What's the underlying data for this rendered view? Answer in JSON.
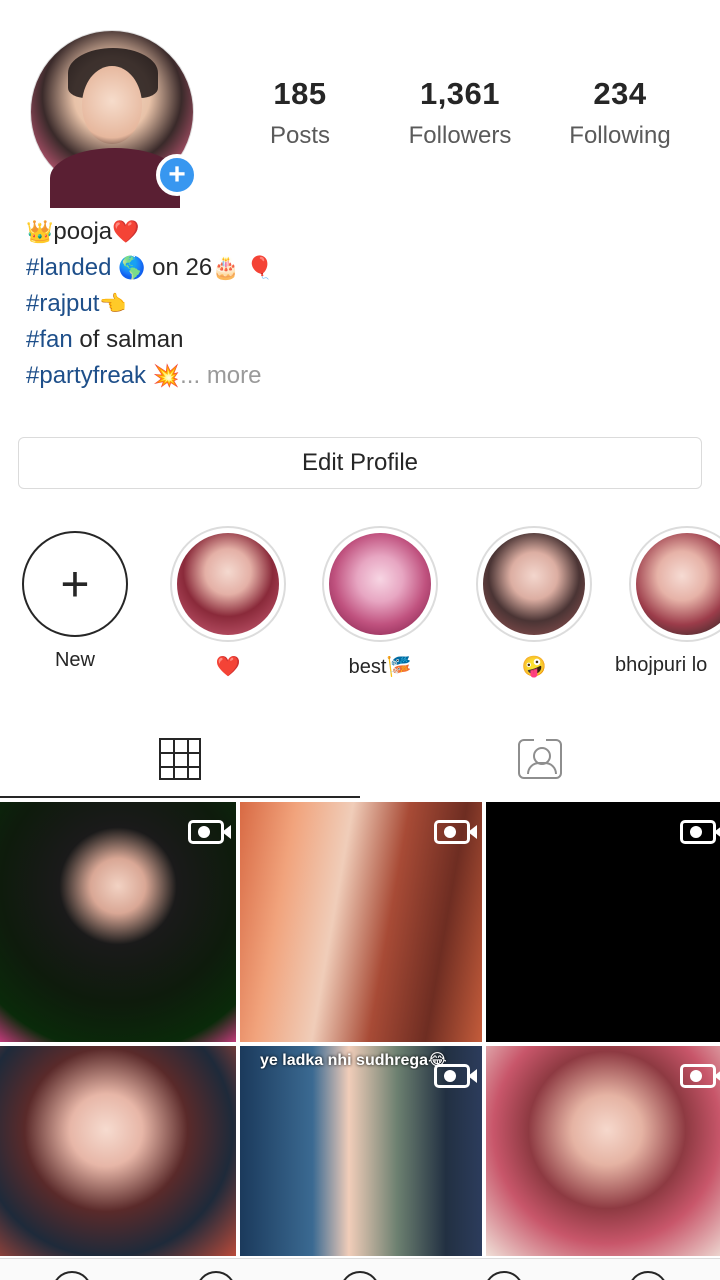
{
  "profile": {
    "stats": [
      {
        "value": "185",
        "label": "Posts"
      },
      {
        "value": "1,361",
        "label": "Followers"
      },
      {
        "value": "234",
        "label": "Following"
      }
    ],
    "add_badge": "+"
  },
  "bio": {
    "name_prefix_emoji": "👑",
    "name": "pooja",
    "name_suffix_emoji": "❤️",
    "line2_tag": "#landed",
    "line2_emoji1": "🌎",
    "line2_text": " on 26",
    "line2_emoji2": "🎂",
    "line2_emoji3": "🎈",
    "line3_tag": "#rajput",
    "line3_emoji": "👈",
    "line4_tag": "#fan",
    "line4_text": " of salman",
    "line5_tag": "#partyfreak",
    "line5_emoji": "💥",
    "more": "... more"
  },
  "edit_profile_label": "Edit Profile",
  "highlights": [
    {
      "label": "New",
      "new_symbol": "+"
    },
    {
      "label": "❤️"
    },
    {
      "label": "best🎏"
    },
    {
      "label": "🤪"
    },
    {
      "label": "bhojpuri lo"
    }
  ],
  "posts": [
    {
      "video": true,
      "caption": ""
    },
    {
      "video": true,
      "caption": ""
    },
    {
      "video": true,
      "caption": ""
    },
    {
      "video": false,
      "caption": ""
    },
    {
      "video": true,
      "caption": "ye ladka nhi sudhrega😂"
    },
    {
      "video": true,
      "caption": ""
    }
  ]
}
